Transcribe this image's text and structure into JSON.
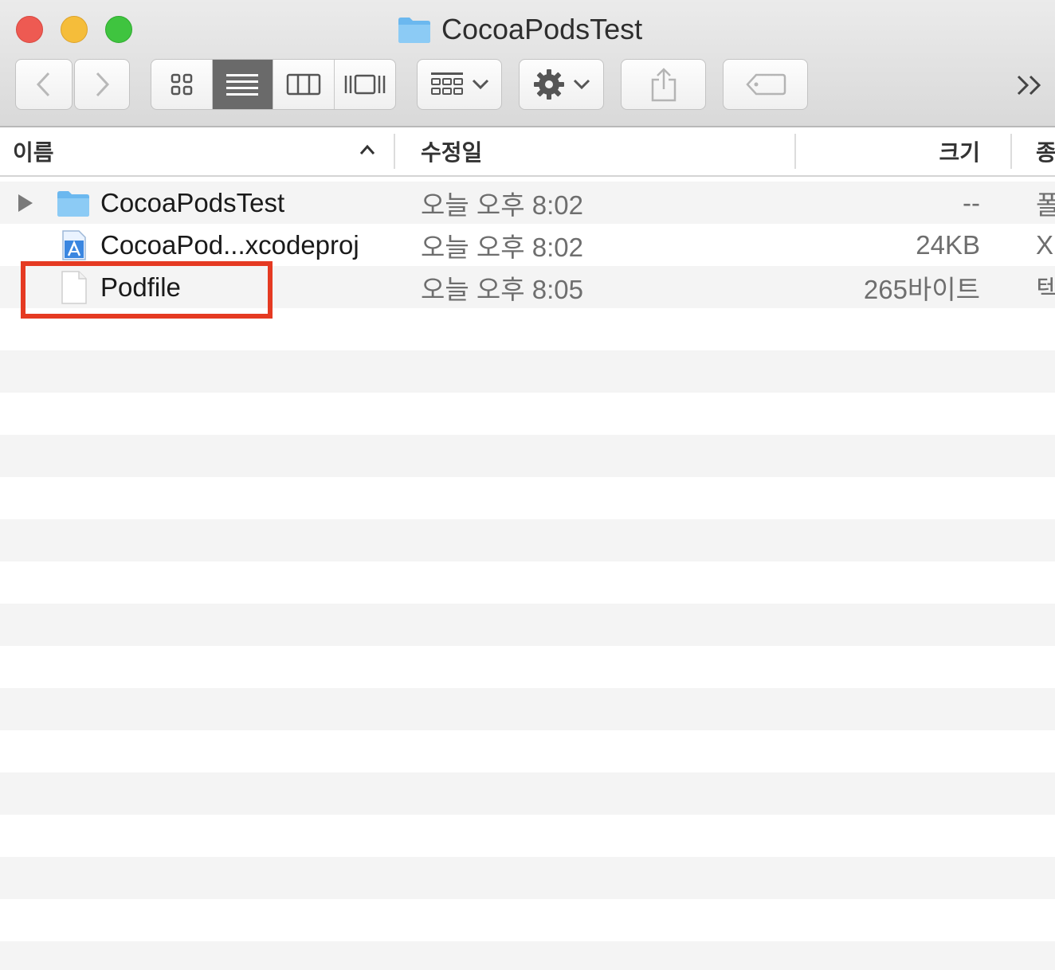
{
  "window": {
    "title": "CocoaPodsTest",
    "traffic_lights": {
      "close": "#ee5a52",
      "minimize": "#f5bd3a",
      "zoom": "#3fc43f"
    }
  },
  "toolbar": {
    "back_icon": "chevron-left-icon",
    "forward_icon": "chevron-right-icon",
    "view_modes": [
      "icon-view",
      "list-view",
      "column-view",
      "cover-flow-view"
    ],
    "active_view": "list-view",
    "group_icon": "group-by-icon",
    "action_icon": "gear-icon",
    "share_icon": "share-icon",
    "tag_icon": "tag-icon",
    "overflow_label": "»"
  },
  "columns": {
    "name": "이름",
    "date": "수정일",
    "size": "크기",
    "kind": "종"
  },
  "files": [
    {
      "name": "CocoaPodsTest",
      "date": "오늘 오후 8:02",
      "size": "--",
      "kind": "폴",
      "icon": "folder-icon",
      "expandable": true
    },
    {
      "name": "CocoaPod...xcodeproj",
      "date": "오늘 오후 8:02",
      "size": "24KB",
      "kind": "X",
      "icon": "xcodeproj-icon",
      "expandable": false
    },
    {
      "name": "Podfile",
      "date": "오늘 오후 8:05",
      "size": "265바이트",
      "kind": "텍",
      "icon": "document-icon",
      "expandable": false,
      "highlighted": true
    }
  ],
  "highlight_color": "#e53a22",
  "folder_color": "#6bb8ef"
}
